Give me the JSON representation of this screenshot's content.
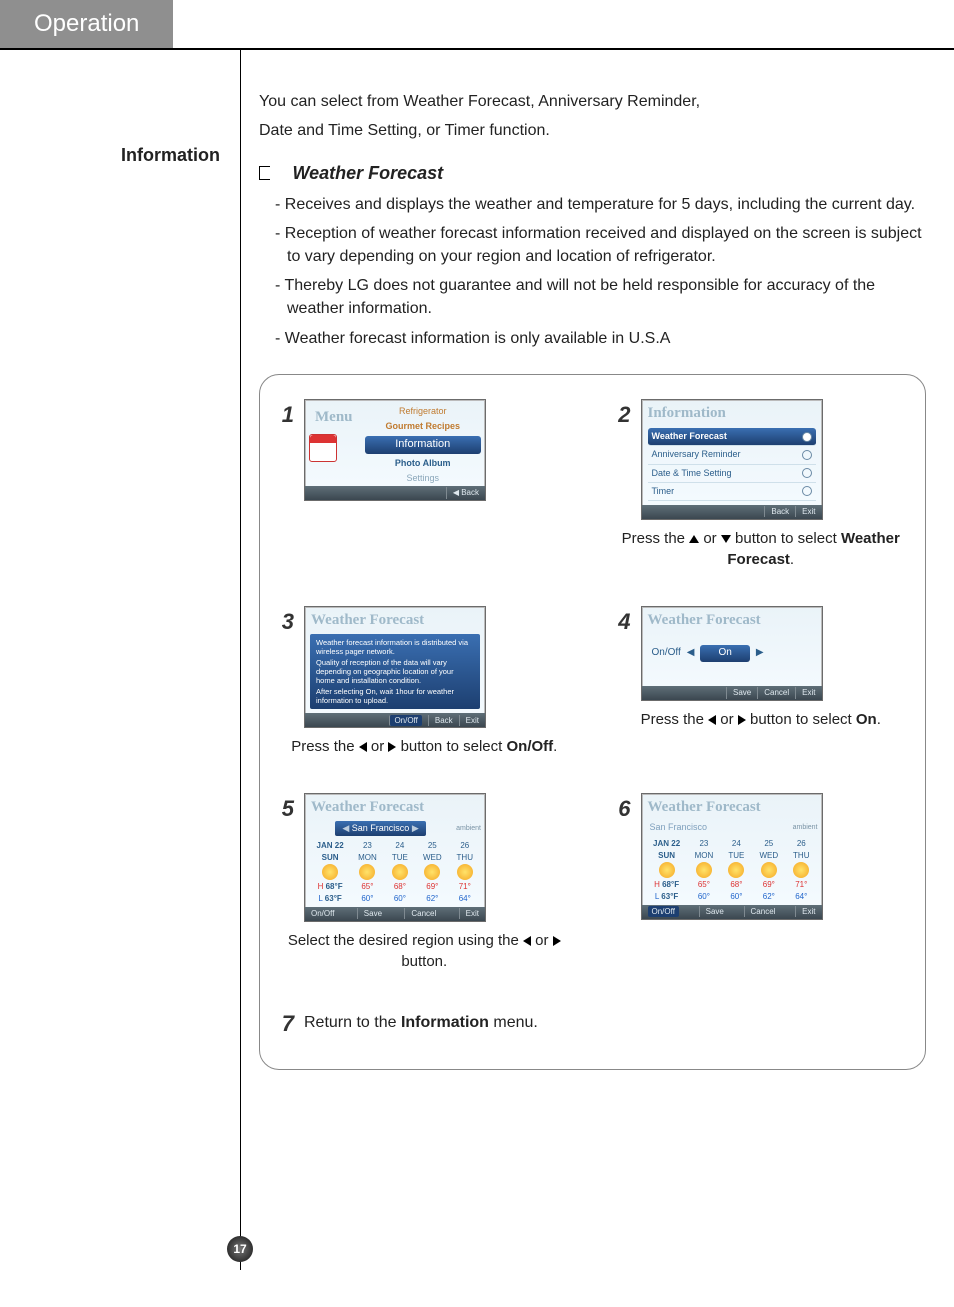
{
  "header": {
    "tab": "Operation",
    "page_number": "17"
  },
  "sidebar": {
    "title": "Information"
  },
  "intro": {
    "line1": "You can select from Weather Forecast, Anniversary Reminder,",
    "line2": "Date and Time Setting, or Timer function."
  },
  "section": {
    "title": "Weather Forecast",
    "bullets": [
      "- Receives and displays the weather and temperature for 5 days, including the current day.",
      "- Reception of weather forecast information received and displayed on the screen is subject to vary depending on your region and location of refrigerator.",
      "- Thereby LG does not guarantee and will not be held responsible for accuracy of the weather information.",
      "- Weather forecast information is only available in U.S.A"
    ]
  },
  "steps": {
    "s1": {
      "num": "1",
      "screen": {
        "title": "Menu",
        "items_top1": "Refrigerator",
        "items_top2": "Gourmet Recipes",
        "selected": "Information",
        "items_bot1": "Photo Album",
        "items_bot2": "Settings",
        "footer_back": "◀ Back"
      }
    },
    "s2": {
      "num": "2",
      "screen": {
        "title": "Information",
        "item_sel": "Weather Forecast",
        "item2": "Anniversary Reminder",
        "item3": "Date & Time Setting",
        "item4": "Timer",
        "footer_back": "Back",
        "footer_exit": "Exit"
      },
      "cap_a": "Press the ",
      "cap_b": " or ",
      "cap_c": " button to select ",
      "cap_bold": "Weather Forecast",
      "cap_d": "."
    },
    "s3": {
      "num": "3",
      "screen": {
        "title": "Weather Forecast",
        "msg1": "Weather forecast information is distributed via wireless pager network.",
        "msg2": "Quality of reception of the data will vary depending on geographic location of your home and installation condition.",
        "msg3": "After selecting On, wait 1hour for weather information to upload.",
        "footer_onoff": "On/Off",
        "footer_back": "Back",
        "footer_exit": "Exit"
      },
      "cap_a": "Press the ",
      "cap_b": " or ",
      "cap_c": " button to select ",
      "cap_bold": "On/Off",
      "cap_d": "."
    },
    "s4": {
      "num": "4",
      "screen": {
        "title": "Weather Forecast",
        "label": "On/Off",
        "value": "On",
        "footer_save": "Save",
        "footer_cancel": "Cancel",
        "footer_exit": "Exit"
      },
      "cap_a": "Press the ",
      "cap_b": " or ",
      "cap_c": " button to select ",
      "cap_bold": "On",
      "cap_d": "."
    },
    "s5": {
      "num": "5",
      "screen": {
        "title": "Weather Forecast",
        "city": "San Francisco",
        "brand": "ambient",
        "today_date": "JAN 22",
        "today_dow": "SUN",
        "d1n": "23",
        "d1w": "MON",
        "d2n": "24",
        "d2w": "TUE",
        "d3n": "25",
        "d3w": "WED",
        "d4n": "26",
        "d4w": "THU",
        "H": "H",
        "L": "L",
        "hi": "68°F",
        "lo": "63°F",
        "d1h": "65°",
        "d1l": "60°",
        "d2h": "68°",
        "d2l": "60°",
        "d3h": "69°",
        "d3l": "62°",
        "d4h": "71°",
        "d4l": "64°",
        "footer_onoff": "On/Off",
        "footer_save": "Save",
        "footer_cancel": "Cancel",
        "footer_exit": "Exit"
      },
      "cap_a": "Select the desired region using the ",
      "cap_b": " or ",
      "cap_c": " button."
    },
    "s6": {
      "num": "6",
      "screen": {
        "title": "Weather Forecast",
        "city": "San Francisco",
        "brand": "ambient",
        "today_date": "JAN 22",
        "today_dow": "SUN",
        "d1n": "23",
        "d1w": "MON",
        "d2n": "24",
        "d2w": "TUE",
        "d3n": "25",
        "d3w": "WED",
        "d4n": "26",
        "d4w": "THU",
        "H": "H",
        "L": "L",
        "hi": "68°F",
        "lo": "63°F",
        "d1h": "65°",
        "d1l": "60°",
        "d2h": "68°",
        "d2l": "60°",
        "d3h": "69°",
        "d3l": "62°",
        "d4h": "71°",
        "d4l": "64°",
        "footer_onoff": "On/Off",
        "footer_save": "Save",
        "footer_cancel": "Cancel",
        "footer_exit": "Exit"
      }
    },
    "s7": {
      "num": "7",
      "cap_a": "Return to the ",
      "cap_bold": "Information",
      "cap_b": " menu."
    }
  }
}
